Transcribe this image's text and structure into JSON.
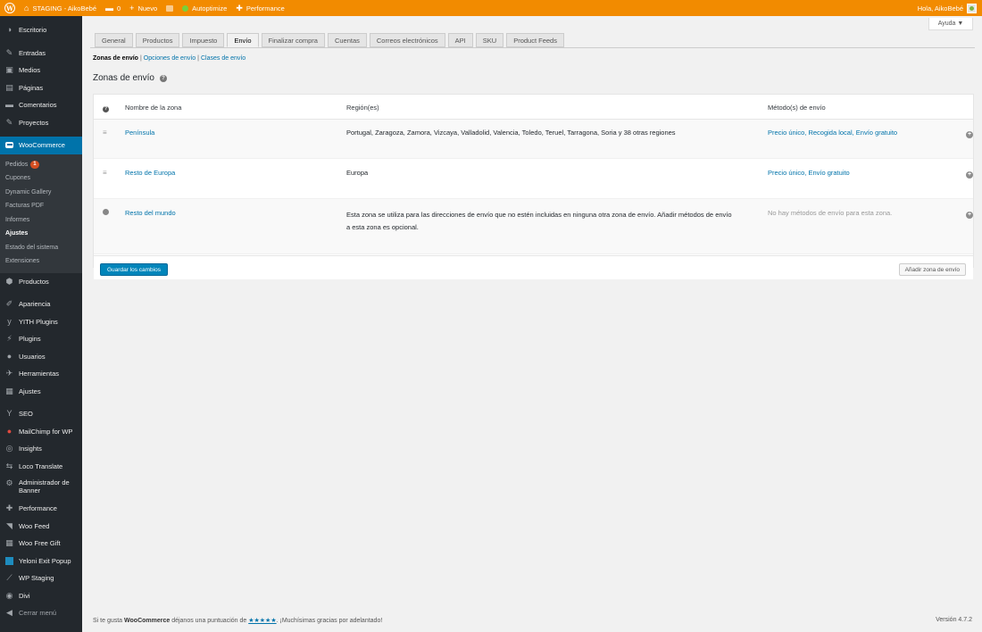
{
  "adminbar": {
    "site_name": "STAGING - AikoBebé",
    "comments_count": "0",
    "new_label": "Nuevo",
    "autoptimize_label": "Autoptimize",
    "performance_label": "Performance",
    "greeting": "Hola, AikoBebé",
    "accent": "#f28b00"
  },
  "sidebar": {
    "top": [
      {
        "label": "Escritorio",
        "icon": "dashboard-icon"
      },
      {
        "label": "Entradas",
        "icon": "pin-icon"
      },
      {
        "label": "Medios",
        "icon": "media-icon"
      },
      {
        "label": "Páginas",
        "icon": "page-icon"
      },
      {
        "label": "Comentarios",
        "icon": "comment-icon"
      },
      {
        "label": "Proyectos",
        "icon": "pin-icon"
      }
    ],
    "woocommerce": "WooCommerce",
    "woo_sub": [
      {
        "label": "Pedidos",
        "badge": "1"
      },
      {
        "label": "Cupones"
      },
      {
        "label": "Dynamic Gallery"
      },
      {
        "label": "Facturas PDF"
      },
      {
        "label": "Informes"
      },
      {
        "label": "Ajustes"
      },
      {
        "label": "Estado del sistema"
      },
      {
        "label": "Extensiones"
      }
    ],
    "productos": "Productos",
    "mid": [
      {
        "label": "Apariencia"
      },
      {
        "label": "YITH Plugins"
      },
      {
        "label": "Plugins"
      },
      {
        "label": "Usuarios"
      },
      {
        "label": "Herramientas"
      },
      {
        "label": "Ajustes"
      }
    ],
    "bottom": [
      {
        "label": "SEO"
      },
      {
        "label": "MailChimp for WP"
      },
      {
        "label": "Insights"
      },
      {
        "label": "Loco Translate"
      },
      {
        "label": "Administrador de Banner"
      },
      {
        "label": "Performance"
      },
      {
        "label": "Woo Feed"
      },
      {
        "label": "Woo Free Gift"
      },
      {
        "label": "Yeloni Exit Popup"
      },
      {
        "label": "WP Staging"
      },
      {
        "label": "Divi"
      },
      {
        "label": "Cerrar menú"
      }
    ]
  },
  "help": "Ayuda ▼",
  "tabs": [
    "General",
    "Productos",
    "Impuesto",
    "Envío",
    "Finalizar compra",
    "Cuentas",
    "Correos electrónicos",
    "API",
    "SKU",
    "Product Feeds"
  ],
  "subsub": [
    "Zonas de envío",
    "Opciones de envío",
    "Clases de envío"
  ],
  "heading": "Zonas de envío",
  "table": {
    "headers": {
      "name": "Nombre de la zona",
      "region": "Región(es)",
      "method": "Método(s) de envío"
    },
    "rows": [
      {
        "name": "Península",
        "region": "Portugal, Zaragoza, Zamora, Vizcaya, Valladolid, Valencia, Toledo, Teruel, Tarragona, Soria y 38 otras regiones",
        "method": "Precio único, Recogida local, Envío gratuito"
      },
      {
        "name": "Resto de Europa",
        "region": "Europa",
        "method": "Precio único, Envío gratuito"
      },
      {
        "name": "Resto del mundo",
        "region_line1": "Esta zona se utiliza para las direcciones de envío que no estén incluidas en ninguna otra zona de envío. Añadir métodos de envío",
        "region_line2": "a esta zona es opcional.",
        "method": "No hay métodos de envío para esta zona."
      }
    ]
  },
  "buttons": {
    "save": "Guardar los cambios",
    "add_zone": "Añadir zona de envío"
  },
  "footer": {
    "part1": "Si te gusta ",
    "brand": "WooCommerce",
    "part2": " déjanos una puntuación de ",
    "stars": "★★★★★",
    "part3": ". ¡Muchísimas gracias por adelantado!",
    "version": "Versión 4.7.2"
  }
}
